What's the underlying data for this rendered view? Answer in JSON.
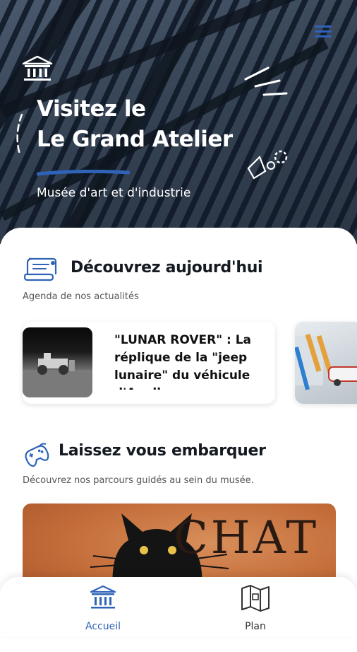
{
  "header": {
    "title_line1": "Visitez le",
    "title_line2": "Le Grand Atelier",
    "subtitle": "Musée d'art et d'industrie",
    "menu_icon": "hamburger-menu-icon",
    "museum_icon": "museum-building-icon"
  },
  "colors": {
    "accent": "#2f63b8",
    "text_dark": "#151a22",
    "text_muted": "#555555"
  },
  "section_today": {
    "icon": "scroll-document-icon",
    "title": "Découvrez aujourd'hui",
    "subtitle": "Agenda de nos actualités",
    "cards": [
      {
        "text": "\"LUNAR ROVER\" : La réplique de la \"jeep lunaire\" du véhicule d'Apollo"
      },
      {
        "text": ""
      }
    ]
  },
  "section_tours": {
    "icon": "gamepad-icon",
    "title": "Laissez vous embarquer",
    "subtitle": "Découvrez nos parcours guidés au sein du musée.",
    "poster_text": "CHAT"
  },
  "bottom_nav": {
    "items": [
      {
        "label": "Accueil",
        "icon": "museum-building-icon",
        "active": true
      },
      {
        "label": "Plan",
        "icon": "map-icon",
        "active": false
      }
    ]
  }
}
